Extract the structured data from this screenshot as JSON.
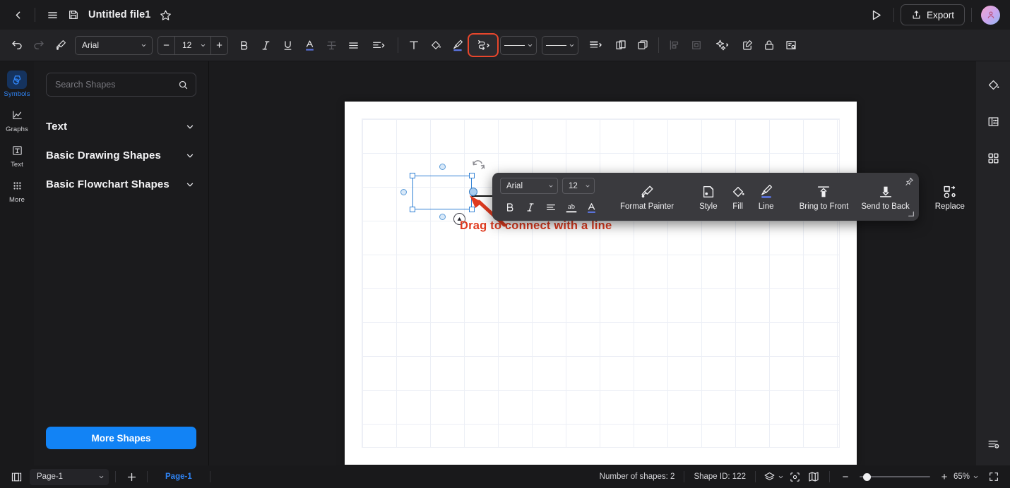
{
  "titlebar": {
    "back_icon": "chevron-left-icon",
    "menu_icon": "hamburger-menu-icon",
    "save_icon": "save-disk-icon",
    "title": "Untitled file1",
    "favorite_icon": "star-icon",
    "present_icon": "play-triangle-icon",
    "export_label": "Export",
    "export_icon": "share-upload-icon",
    "avatar_icon": "user-avatar"
  },
  "toolbar": {
    "undo_icon": "undo-arrow-icon",
    "redo_icon": "redo-arrow-icon",
    "format_painter_icon": "format-painter-icon",
    "font_family": "Arial",
    "font_size": "12",
    "decrease_label": "−",
    "increase_label": "+",
    "bold_label": "B",
    "italic_label": "I",
    "underline_label": "U",
    "font_color_label": "A",
    "strikethrough_label": "T",
    "align_icon": "align-left-icon",
    "line_spacing_icon": "line-spacing-icon",
    "text_box_label": "T",
    "fill_icon": "paint-bucket-icon",
    "line_color_icon": "brush-icon",
    "connector_icon": "connector-line-icon",
    "connector_highlight_color": "#e8462c",
    "line_style_icon": "line-style-icon",
    "arrow_style_icon": "arrow-style-icon",
    "line_width_icon": "line-width-icon",
    "group_icon": "group-icon",
    "duplicate_icon": "duplicate-icon",
    "align_objects_icon": "align-objects-icon",
    "crop_icon": "crop-icon",
    "effects_icon": "magic-wand-icon",
    "edit_icon": "edit-pencil-icon",
    "lock_icon": "lock-icon",
    "notes_icon": "notes-search-icon"
  },
  "left_rail": {
    "items": [
      {
        "label": "Symbols",
        "icon": "symbols-shapes-icon",
        "active": true
      },
      {
        "label": "Graphs",
        "icon": "graph-chart-icon",
        "active": false
      },
      {
        "label": "Text",
        "icon": "text-box-icon",
        "active": false
      },
      {
        "label": "More",
        "icon": "more-grid-dots-icon",
        "active": false
      }
    ],
    "active_color": "#2f84f5"
  },
  "panel": {
    "search_placeholder": "Search Shapes",
    "search_value": "",
    "search_icon": "search-icon",
    "categories": [
      {
        "label": "Text",
        "chevron": "chevron-down-icon"
      },
      {
        "label": "Basic Drawing Shapes",
        "chevron": "chevron-down-icon"
      },
      {
        "label": "Basic Flowchart Shapes",
        "chevron": "chevron-down-icon"
      }
    ],
    "more_shapes_label": "More Shapes",
    "more_shapes_color": "#1283f5"
  },
  "format_bar": {
    "font_family": "Arial",
    "font_size": "12",
    "bold_label": "B",
    "italic_label": "I",
    "align_icon": "align-left-icon",
    "strike_label": "ab",
    "font_color_label": "A",
    "items": [
      {
        "label": "Format Painter",
        "icon": "format-painter-icon"
      },
      {
        "label": "Style",
        "icon": "style-icon"
      },
      {
        "label": "Fill",
        "icon": "paint-bucket-icon"
      },
      {
        "label": "Line",
        "icon": "brush-line-icon"
      },
      {
        "label": "Bring to Front",
        "icon": "bring-to-front-icon"
      },
      {
        "label": "Send to Back",
        "icon": "send-to-back-icon"
      },
      {
        "label": "Replace",
        "icon": "replace-shape-icon"
      }
    ],
    "pin_icon": "pin-icon",
    "resize_icon": "resize-grip-icon"
  },
  "canvas": {
    "hint_text": "Drag to connect with a line",
    "hint_color": "#e03b20",
    "selected_shape_border": "#2e7fd4",
    "target_shape_border": "#a5aede",
    "rotate_icon": "rotate-handle-icon",
    "shape_menu_icon": "shape-menu-triangle-icon",
    "arrow_icon": "red-pointer-arrow-icon",
    "connector_arrow_icon": "connector-arrow-icon"
  },
  "right_rail": {
    "items": [
      {
        "icon": "paint-bucket-icon"
      },
      {
        "icon": "panel-settings-icon"
      },
      {
        "icon": "grid-apps-icon"
      }
    ],
    "bottom_icon": "layers-list-icon"
  },
  "status": {
    "toggle_panel_icon": "toggle-panel-icon",
    "page_name": "Page-1",
    "page_chevron": "chevron-down-icon",
    "add_page_icon": "plus-icon",
    "page_tab_label": "Page-1",
    "shapes_count_label": "Number of shapes: 2",
    "shape_id_label": "Shape ID: 122",
    "layers_icon": "layers-icon",
    "focus_icon": "focus-target-icon",
    "map_icon": "map-overview-icon",
    "zoom_out_label": "−",
    "zoom_in_label": "+",
    "zoom_value": "65%",
    "zoom_chevron": "chevron-down-icon",
    "fullscreen_icon": "fullscreen-icon"
  }
}
